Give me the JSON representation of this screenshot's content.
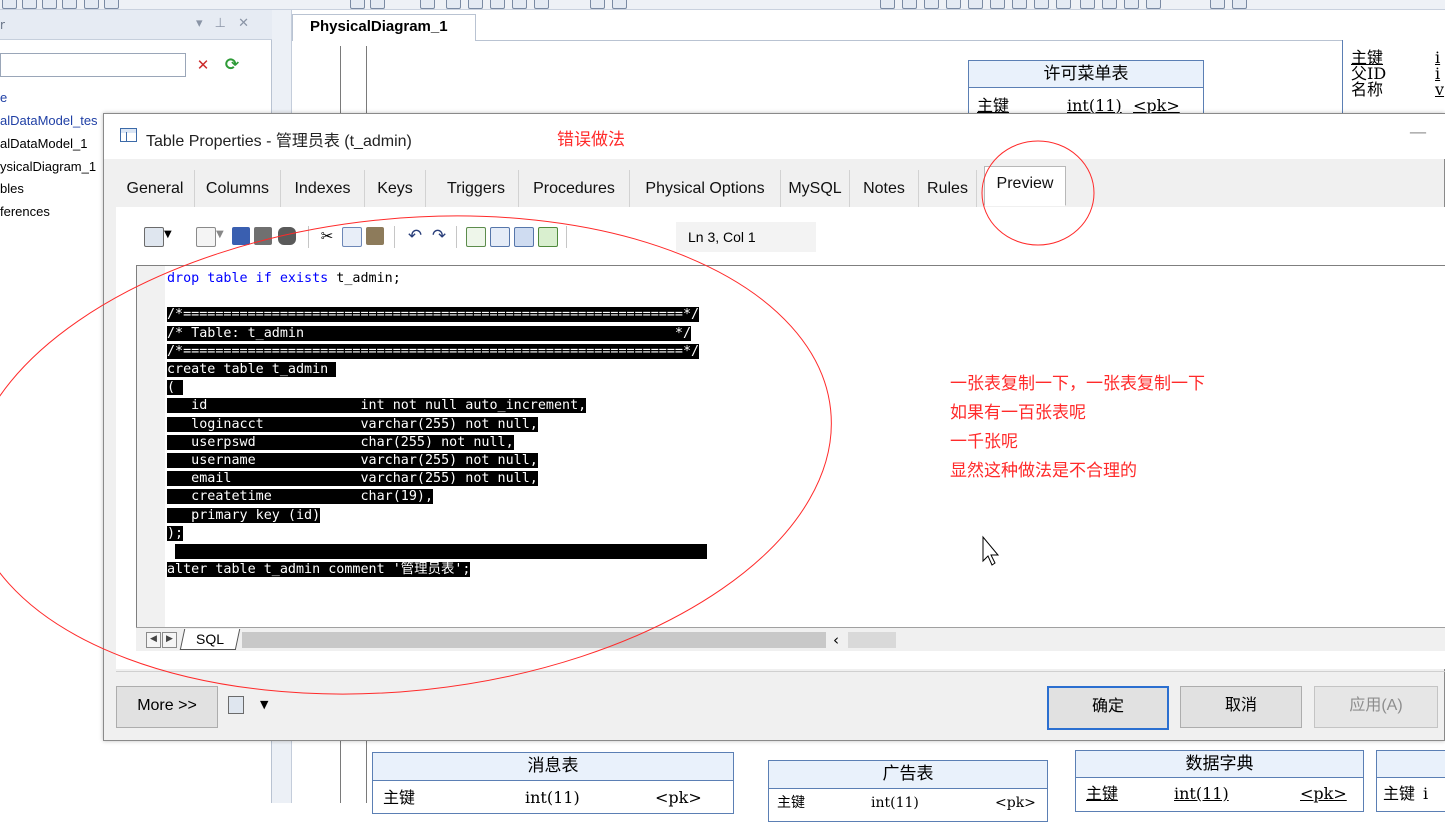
{
  "browser": {
    "title": "r",
    "controls": "▾ ⊥ ✕",
    "tree_items": [
      "e",
      "alDataModel_tes",
      "alDataModel_1",
      "ysicalDiagram_1",
      "bles",
      "ferences"
    ]
  },
  "diagram": {
    "tab_label": "PhysicalDiagram_1",
    "entities": {
      "permission_menu": {
        "title": "许可菜单表",
        "row": {
          "key": "主键",
          "type": "int(11)",
          "pk": "<pk>"
        }
      },
      "right_table": {
        "rows": [
          {
            "key": "主键",
            "extra": "i"
          },
          {
            "key": "父ID",
            "extra": "i"
          },
          {
            "key": "名称",
            "extra": "v"
          }
        ]
      },
      "message": {
        "title": "消息表",
        "row": {
          "key": "主键",
          "type": "int(11)",
          "pk": "<pk>"
        }
      },
      "ad": {
        "title": "广告表",
        "row": {
          "key": "主键",
          "type": "int(11)",
          "pk": "<pk>"
        }
      },
      "dictionary": {
        "title": "数据字典",
        "row": {
          "key": "主键",
          "type": "int(11)",
          "pk": "<pk>"
        }
      },
      "partial": {
        "row": {
          "key": "主键",
          "extra": "i"
        }
      }
    }
  },
  "dialog": {
    "title": "Table Properties - 管理员表 (t_admin)",
    "min_glyph": "—",
    "tabs": [
      {
        "label": "General",
        "active": false
      },
      {
        "label": "Columns",
        "active": false
      },
      {
        "label": "Indexes",
        "active": false
      },
      {
        "label": "Keys",
        "active": false
      },
      {
        "label": "Triggers",
        "active": false
      },
      {
        "label": "Procedures",
        "active": false
      },
      {
        "label": "Physical Options",
        "active": false
      },
      {
        "label": "MySQL",
        "active": false
      },
      {
        "label": "Notes",
        "active": false
      },
      {
        "label": "Rules",
        "active": false
      },
      {
        "label": "Preview",
        "active": true
      }
    ],
    "cursor_position": "Ln 3, Col 1",
    "code": {
      "line1_kw": "drop table if exists",
      "line1_rest": " t_admin;",
      "banner_top": "/*==============================================================*/",
      "banner_mid": "/* Table: t_admin                                              */",
      "banner_bot": "/*==============================================================*/",
      "create": "create table t_admin ",
      "open": "( ",
      "col_id": "   id                   int not null auto_increment,",
      "col_loginacct": "   loginacct            varchar(255) not null,",
      "col_userpswd": "   userpswd             char(255) not null,",
      "col_username": "   username             varchar(255) not null,",
      "col_email": "   email                varchar(255) not null,",
      "col_createtime": "   createtime           char(19),",
      "col_pk": "   primary key (id)",
      "close": ");",
      "blank": " ",
      "alter": "alter table t_admin comment '管理员表';"
    },
    "sheet_tab": "SQL",
    "buttons": {
      "more": "More >>",
      "ok": "确定",
      "cancel": "取消",
      "apply": "应用(A)"
    }
  },
  "annotations": {
    "wrong_way": "错误做法",
    "note_lines": [
      "一张表复制一下，一张表复制一下",
      "如果有一百张表呢",
      "一千张呢",
      "显然这种做法是不合理的"
    ],
    "color": "#ff2a2a"
  }
}
